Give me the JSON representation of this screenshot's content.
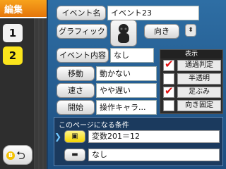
{
  "header": {
    "title": "編集"
  },
  "pages": [
    {
      "label": "1",
      "active": false
    },
    {
      "label": "2",
      "active": true
    }
  ],
  "footer": {
    "b_badge": "B"
  },
  "fields": {
    "event_name_label": "イベント名",
    "event_name_value": "イベント23",
    "graphic_label": "グラフィック",
    "direction_label": "向き",
    "event_content_label": "イベント内容",
    "event_content_value": "なし",
    "movement_label": "移動",
    "movement_value": "動かない",
    "speed_label": "速さ",
    "speed_value": "やや遅い",
    "start_label": "開始",
    "start_value": "操作キャラ..."
  },
  "options": {
    "title": "表示",
    "items": [
      {
        "label": "通過判定",
        "checked": true
      },
      {
        "label": "半透明",
        "checked": false
      },
      {
        "label": "足ぶみ",
        "checked": true
      },
      {
        "label": "向き固定",
        "checked": false
      }
    ]
  },
  "conditions": {
    "title": "このページになる条件",
    "items": [
      {
        "value": "変数201＝12",
        "active": true
      },
      {
        "value": "なし",
        "active": false
      }
    ]
  },
  "colors": {
    "accent_orange": "#f0901a",
    "panel_blue": "#2e6ea4",
    "active_page_yellow": "#fbe51c",
    "check_red": "#e01010"
  }
}
